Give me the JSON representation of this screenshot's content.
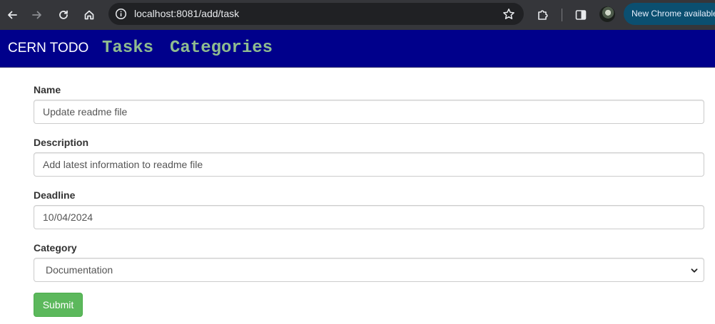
{
  "browser": {
    "url": "localhost:8081/add/task",
    "update_label": "New Chrome available",
    "colors": {
      "toolbar": "#35363a",
      "omnibox": "#202124",
      "update_pill": "#0b4f70"
    }
  },
  "navbar": {
    "brand": "CERN TODO",
    "links": [
      {
        "label": "Tasks"
      },
      {
        "label": "Categories"
      }
    ],
    "colors": {
      "background": "#00008b",
      "link": "#8fbc8f"
    }
  },
  "form": {
    "fields": [
      {
        "label": "Name",
        "value": "Update readme file"
      },
      {
        "label": "Description",
        "value": "Add latest information to readme file"
      },
      {
        "label": "Deadline",
        "value": "10/04/2024"
      },
      {
        "label": "Category",
        "value": "Documentation"
      }
    ],
    "submit_label": "Submit",
    "colors": {
      "submit": "#5cb85c"
    }
  }
}
